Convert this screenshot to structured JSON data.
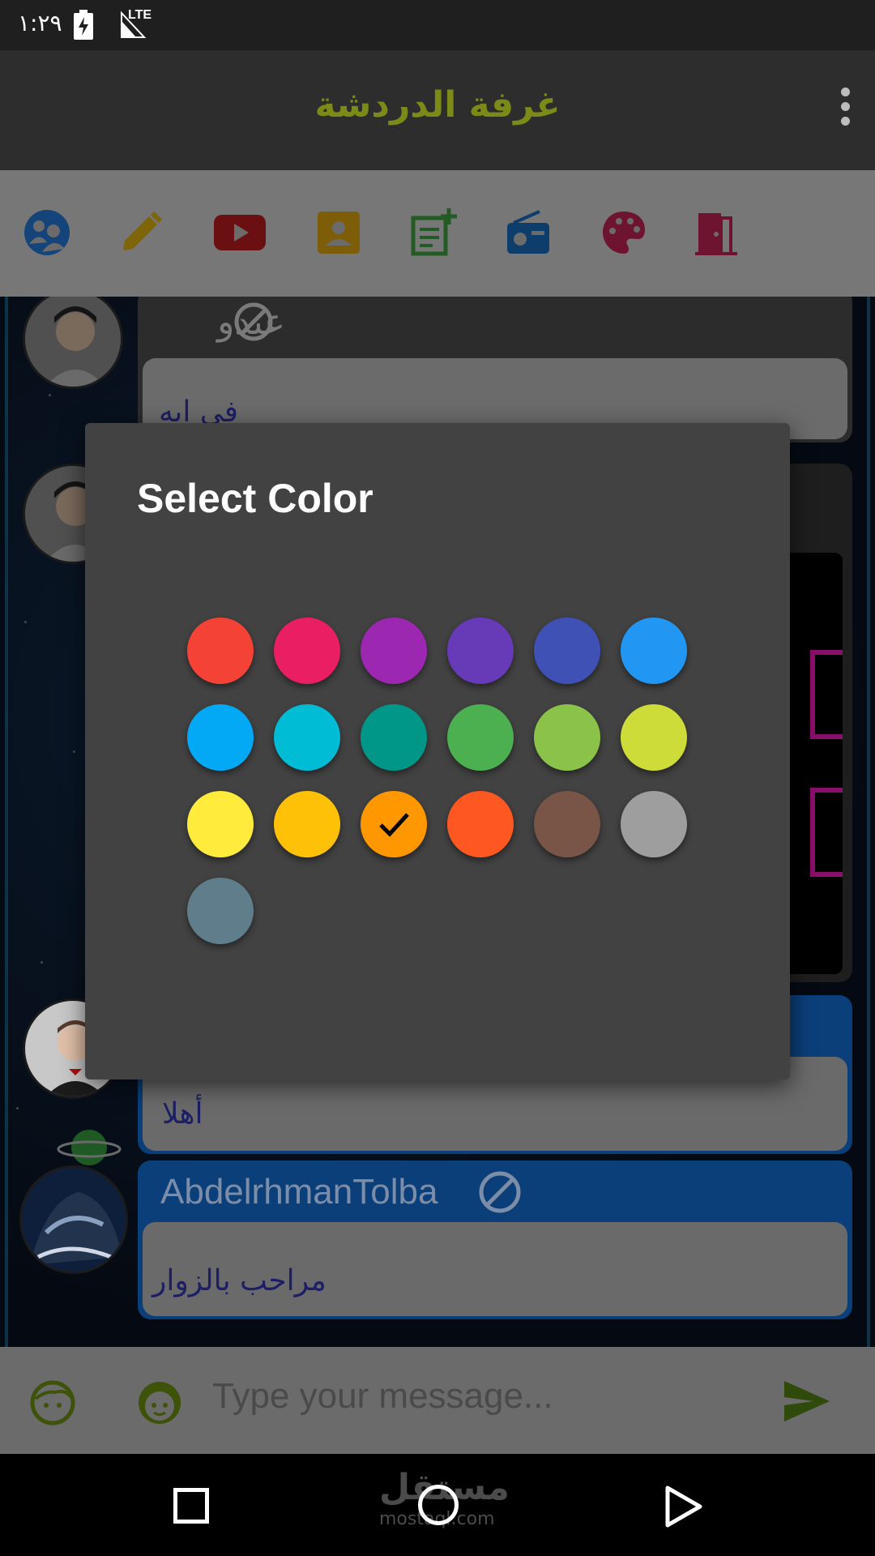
{
  "status_bar": {
    "time": "١:٢٩",
    "network": "LTE"
  },
  "app_bar": {
    "title": "غرفة الدردشة"
  },
  "toolbar_icons": [
    "members-icon",
    "edit-icon",
    "youtube-icon",
    "contact-icon",
    "add-post-icon",
    "radio-icon",
    "palette-icon",
    "exit-door-icon"
  ],
  "messages": [
    {
      "name": "عبدو",
      "text": "في ابه"
    },
    {
      "name": "",
      "text": "أهلا"
    },
    {
      "name": "AbdelrhmanTolba",
      "text": "مراحب بالزوار"
    }
  ],
  "composer": {
    "placeholder": "Type your message..."
  },
  "nav_bar": {
    "watermark": "مستقل",
    "watermark_sub": "mostaql.com"
  },
  "dialog": {
    "title": "Select Color",
    "selected_index": 14,
    "colors": [
      "#f44336",
      "#e91e63",
      "#9c27b0",
      "#673ab7",
      "#3f51b5",
      "#2196f3",
      "#03a9f4",
      "#00bcd4",
      "#009688",
      "#4caf50",
      "#8bc34a",
      "#cddc39",
      "#ffeb3b",
      "#ffc107",
      "#ff9800",
      "#ff5722",
      "#795548",
      "#9e9e9e",
      "#607d8b"
    ]
  }
}
